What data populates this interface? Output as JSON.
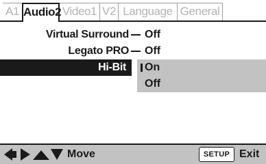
{
  "tabs": [
    {
      "label": "A1",
      "active": false
    },
    {
      "label": "Audio2",
      "active": true
    },
    {
      "label": "Video1",
      "active": false
    },
    {
      "label": "V2",
      "active": false
    },
    {
      "label": "Language",
      "active": false
    },
    {
      "label": "General",
      "active": false
    }
  ],
  "settings": [
    {
      "label": "Virtual Surround",
      "value": "Off"
    },
    {
      "label": "Legato PRO",
      "value": "Off"
    },
    {
      "label": "Hi-Bit",
      "value": "",
      "selected": true
    }
  ],
  "options": {
    "items": [
      "On",
      "Off"
    ],
    "highlighted": "On"
  },
  "footer": {
    "arrow_icons": [
      "arrow-left-icon",
      "arrow-right-icon",
      "arrow-up-icon",
      "arrow-down-icon"
    ],
    "move_label": "Move",
    "setup_button": "SETUP",
    "exit_label": "Exit"
  },
  "colors": {
    "text": "#1a1a1a",
    "inactive_tab_text": "#b3b3b3",
    "highlight_bg": "#1a1a1a",
    "panel_gray": "#c2c2c2",
    "background": "#ffffff"
  }
}
